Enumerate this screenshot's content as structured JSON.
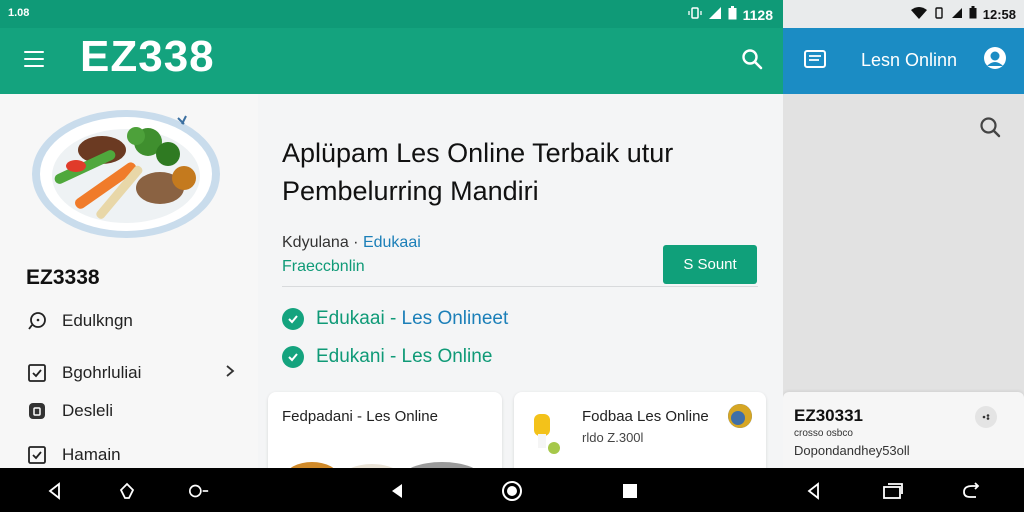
{
  "left": {
    "status": {
      "left_text": "1.08",
      "time": "1128"
    },
    "appbar": {
      "brand": "EZ338"
    },
    "drawer": {
      "site_name": "EZ3338",
      "items": [
        {
          "label": "Edulkngn",
          "icon": "chat-icon"
        },
        {
          "label": "Bgohrluliai",
          "icon": "checkbox-icon"
        },
        {
          "label": "Desleli",
          "icon": "lock-icon"
        },
        {
          "label": "Hamain",
          "icon": "checkbox-icon"
        }
      ]
    },
    "content": {
      "headline_line1": "Aplüpam Les Online Terbaik utur",
      "headline_line2": "Pembelurring Mandiri",
      "meta_prefix": "Kdyulana ·",
      "meta_link": "Edukaai",
      "meta_sub": "Fraeccbnlin",
      "button": "S Sount",
      "checks": [
        {
          "green": "Edukaai - ",
          "blue": "Les Onlineet"
        },
        {
          "green": "Edukani - Les Online",
          "blue": ""
        }
      ],
      "cards": [
        {
          "title": "Fedpadani - Les Online"
        },
        {
          "title": "Fodbaa Les Online",
          "subtitle": "rldo Z.300l"
        }
      ]
    }
  },
  "right": {
    "status": {
      "time": "12:58"
    },
    "appbar": {
      "title": "Lesn Onlinn"
    },
    "card": {
      "title": "EZ30331",
      "sub1": "crosso osbco",
      "sub2": "Dopondandhey53oll"
    }
  },
  "colors": {
    "green_primary": "#14a37e",
    "blue_primary": "#1b8cc4",
    "link_blue": "#1b7fb8"
  }
}
